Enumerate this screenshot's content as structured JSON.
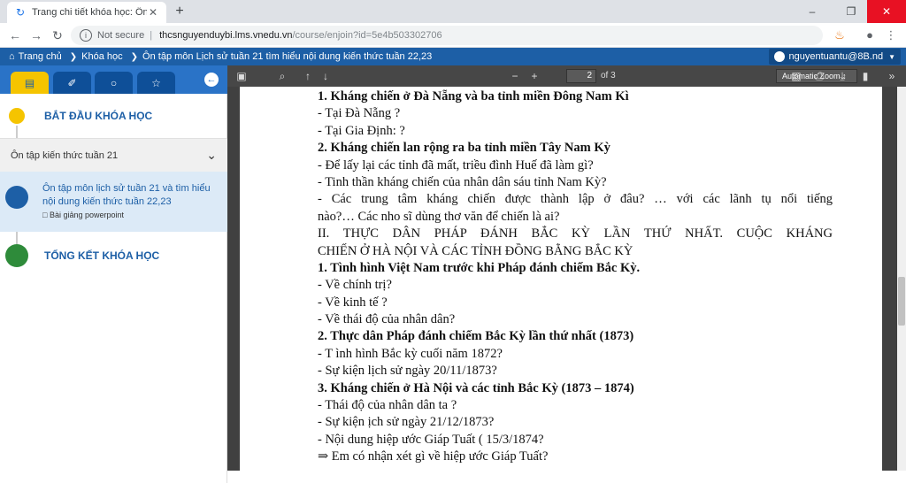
{
  "browser": {
    "tab_title": "Trang chi tiết khóa học: Ôn tập m",
    "url_security": "Not secure",
    "url_host": "thcsnguyenduybi.lms.vnedu.vn",
    "url_path": "/course/enjoin?id=5e4b503302706"
  },
  "sitenav": {
    "crumbs": [
      "Trang chủ",
      "Khóa học",
      "Ôn tập môn Lịch sử tuần 21 tìm hiểu nội dung kiến thức tuần 22,23"
    ],
    "user": "nguyentuantu@8B.nd"
  },
  "sidebar": {
    "start_label": "BẮT ĐẦU KHÓA HỌC",
    "week_header": "Ôn tập kiến thức tuần 21",
    "lesson_title": "Ôn tập môn lịch sử tuần 21 và tìm hiểu nội dung kiến thức tuần 22,23",
    "lesson_type": "Bài giảng powerpoint",
    "end_label": "TỔNG KẾT KHÓA HỌC"
  },
  "pdf_toolbar": {
    "page_current": "2",
    "page_total": "of 3",
    "zoom": "Automatic Zoom"
  },
  "pdf_lines": [
    {
      "text": "1. Kháng chiến ở Đà Nẵng và ba tỉnh miền Đông Nam Kì",
      "bold": true,
      "justify": false
    },
    {
      "text": "- Tại Đà Nẵng ?",
      "bold": false,
      "justify": false
    },
    {
      "text": "- Tại Gia Định: ?",
      "bold": false,
      "justify": false
    },
    {
      "text": "2. Kháng chiến lan rộng ra ba tỉnh miền Tây Nam Kỳ",
      "bold": true,
      "justify": false
    },
    {
      "text": "- Để lấy lại các tỉnh đã mất, triều đình Huế đã làm gì?",
      "bold": false,
      "justify": false
    },
    {
      "text": "- Tinh thần kháng chiến của nhân dân sáu tỉnh Nam Kỳ?",
      "bold": false,
      "justify": false
    },
    {
      "text": "- Các trung tâm kháng chiến được thành lập ở đâu? … với các lãnh tụ nổi tiếng",
      "bold": false,
      "justify": true
    },
    {
      "text": "nào?… Các nho sĩ dùng thơ văn để chiến là ai?",
      "bold": false,
      "justify": false
    },
    {
      "text": "II. THỰC DÂN PHÁP ĐÁNH BẮC KỲ LẦN THỨ NHẤT. CUỘC KHÁNG",
      "bold": false,
      "justify": true
    },
    {
      "text": "CHIẾN Ở HÀ NỘI VÀ CÁC TỈNH ĐỒNG BẰNG BẮC KỲ",
      "bold": false,
      "justify": false
    },
    {
      "text": "1. Tình hình Việt Nam trước khi Pháp đánh chiếm Bắc Kỳ.",
      "bold": true,
      "justify": false
    },
    {
      "text": "- Về chính trị?",
      "bold": false,
      "justify": false
    },
    {
      "text": "- Về kinh tế ?",
      "bold": false,
      "justify": false
    },
    {
      "text": "- Về thái độ của nhân dân?",
      "bold": false,
      "justify": false
    },
    {
      "text": "2. Thực dân Pháp đánh chiếm Bắc Kỳ lần thứ nhất (1873)",
      "bold": true,
      "justify": false
    },
    {
      "text": "-  T ình hình Bắc kỳ cuối năm 1872?",
      "bold": false,
      "justify": false
    },
    {
      "text": "-  Sự kiện lịch sử ngày 20/11/1873?",
      "bold": false,
      "justify": false
    },
    {
      "text": "3. Kháng chiến ở Hà Nội và các tỉnh Bắc Kỳ (1873 – 1874)",
      "bold": true,
      "justify": false
    },
    {
      "text": "- Thái độ của nhân dân ta ?",
      "bold": false,
      "justify": false
    },
    {
      "text": "- Sự kiện ịch sử ngày 21/12/1873?",
      "bold": false,
      "justify": false
    },
    {
      "text": "- Nội dung hiệp ước Giáp Tuất ( 15/3/1874?",
      "bold": false,
      "justify": false
    },
    {
      "text": "⇒ Em có nhận xét gì về hiệp ước Giáp Tuất?",
      "bold": false,
      "justify": false
    }
  ],
  "colors": {
    "site_blue": "#1d5fa6",
    "tab_yellow": "#f5c400",
    "dot_green": "#2e8b3a",
    "dot_blue": "#1d5fa6"
  }
}
